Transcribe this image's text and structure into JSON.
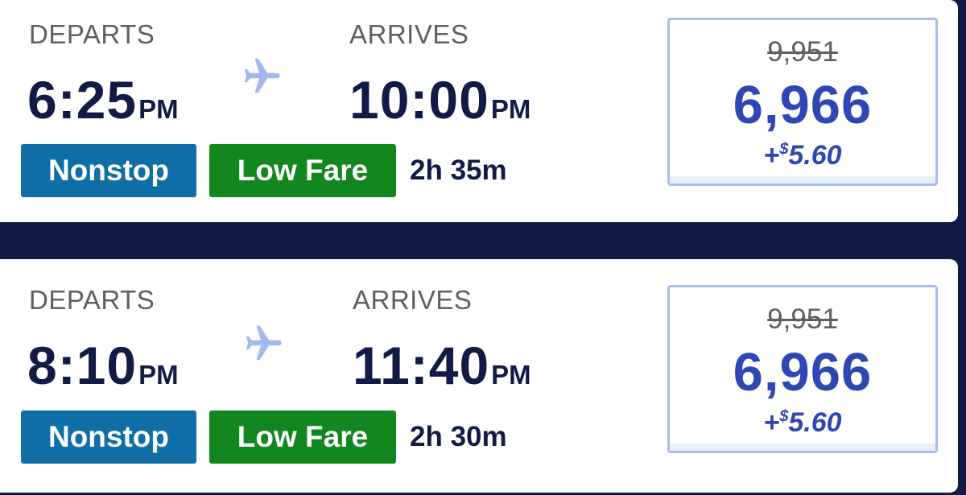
{
  "flights": [
    {
      "departs_label": "DEPARTS",
      "departs_time": "6:25",
      "departs_ampm": "PM",
      "arrives_label": "ARRIVES",
      "arrives_time": "10:00",
      "arrives_ampm": "PM",
      "badge_nonstop": "Nonstop",
      "badge_lowfare": "Low Fare",
      "duration": "2h 35m",
      "old_fare": "9,951",
      "new_fare": "6,966",
      "tax_prefix": "+",
      "tax_currency": "$",
      "tax_amount": "5.60"
    },
    {
      "departs_label": "DEPARTS",
      "departs_time": "8:10",
      "departs_ampm": "PM",
      "arrives_label": "ARRIVES",
      "arrives_time": "11:40",
      "arrives_ampm": "PM",
      "badge_nonstop": "Nonstop",
      "badge_lowfare": "Low Fare",
      "duration": "2h 30m",
      "old_fare": "9,951",
      "new_fare": "6,966",
      "tax_prefix": "+",
      "tax_currency": "$",
      "tax_amount": "5.60"
    }
  ],
  "icons": {
    "plane": "airplane-icon"
  },
  "colors": {
    "background": "#121b44",
    "nonstop": "#0f6ea6",
    "lowfare": "#12861f",
    "fare_blue": "#2f47b4",
    "plane": "#a4b8ef"
  }
}
